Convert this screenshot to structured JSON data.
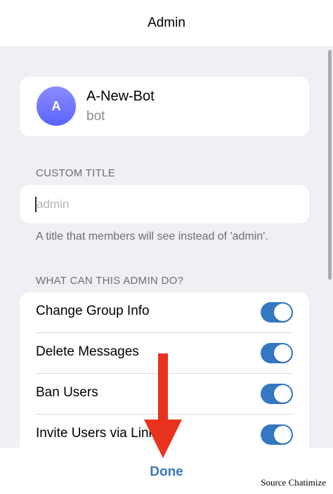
{
  "header": {
    "title": "Admin"
  },
  "profile": {
    "avatar_letter": "A",
    "name": "A-New-Bot",
    "subtitle": "bot"
  },
  "custom_title": {
    "section_label": "CUSTOM TITLE",
    "placeholder": "admin",
    "value": "",
    "hint": "A title that members will see instead of 'admin'."
  },
  "permissions": {
    "section_label": "WHAT CAN THIS ADMIN DO?",
    "items": [
      {
        "label": "Change Group Info",
        "enabled": true
      },
      {
        "label": "Delete Messages",
        "enabled": true
      },
      {
        "label": "Ban Users",
        "enabled": true
      },
      {
        "label": "Invite Users via Link",
        "enabled": true
      }
    ]
  },
  "footer": {
    "done_label": "Done",
    "source": "Source Chatimize"
  },
  "colors": {
    "accent": "#3a77bd",
    "toggle_on": "#3478c4",
    "annotation_arrow": "#e8321e",
    "background": "#efeff4"
  }
}
